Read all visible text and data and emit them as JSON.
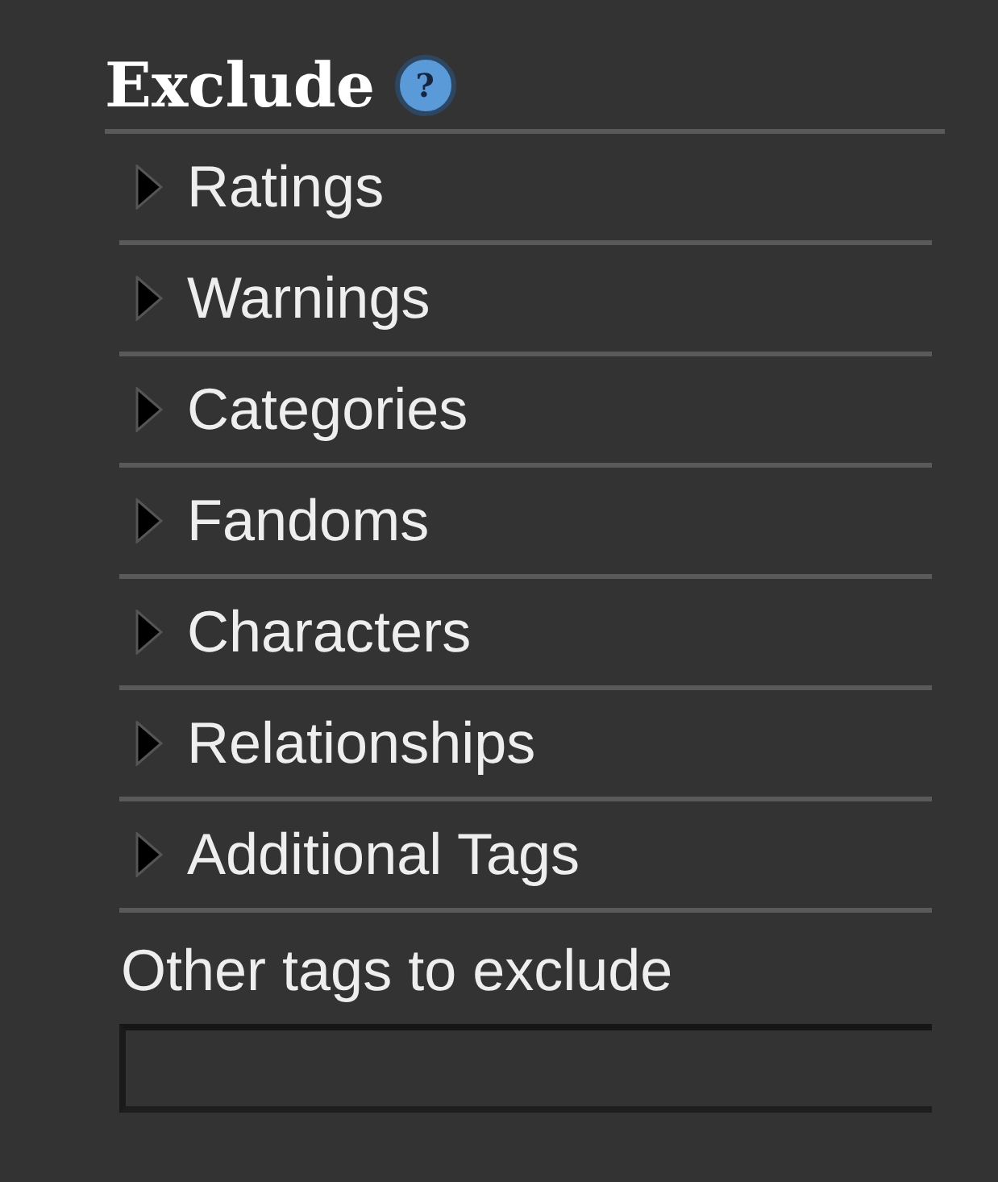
{
  "section": {
    "title": "Exclude",
    "help_label": "?"
  },
  "filters": [
    {
      "label": "Ratings",
      "expanded": false
    },
    {
      "label": "Warnings",
      "expanded": false
    },
    {
      "label": "Categories",
      "expanded": false
    },
    {
      "label": "Fandoms",
      "expanded": false
    },
    {
      "label": "Characters",
      "expanded": false
    },
    {
      "label": "Relationships",
      "expanded": false
    },
    {
      "label": "Additional Tags",
      "expanded": false
    }
  ],
  "other_tags": {
    "label": "Other tags to exclude"
  }
}
